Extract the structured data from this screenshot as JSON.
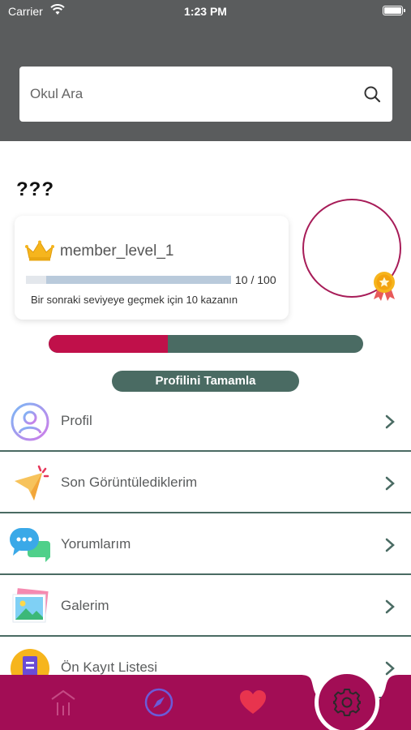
{
  "status_bar": {
    "carrier": "Carrier",
    "time": "1:23 PM"
  },
  "search": {
    "placeholder": "Okul Ara"
  },
  "profile": {
    "username": "???",
    "level_name": "member_level_1",
    "level_progress_text": "10 / 100",
    "level_progress_fraction": 0.1,
    "level_description": "Bir sonraki seviyeye geçmek için 10 kazanın",
    "completion_fraction": 0.38,
    "complete_button_label": "Profilini Tamamla"
  },
  "menu": {
    "items": [
      {
        "label": "Profil",
        "icon": "user-circle-icon"
      },
      {
        "label": "Son Görüntülediklerim",
        "icon": "cursor-click-icon"
      },
      {
        "label": "Yorumlarım",
        "icon": "chat-bubbles-icon"
      },
      {
        "label": "Galerim",
        "icon": "gallery-icon"
      },
      {
        "label": "Ön Kayıt Listesi",
        "icon": "form-list-icon"
      }
    ]
  },
  "bottom_nav": {
    "items": [
      "school-icon",
      "compass-icon",
      "heart-icon",
      "settings-gear-icon"
    ],
    "active": "settings-gear-icon"
  },
  "colors": {
    "primary": "#a20d55",
    "secondary": "#4a6b63",
    "header": "#5a5c5d",
    "progress_fill": "#c0104a"
  }
}
